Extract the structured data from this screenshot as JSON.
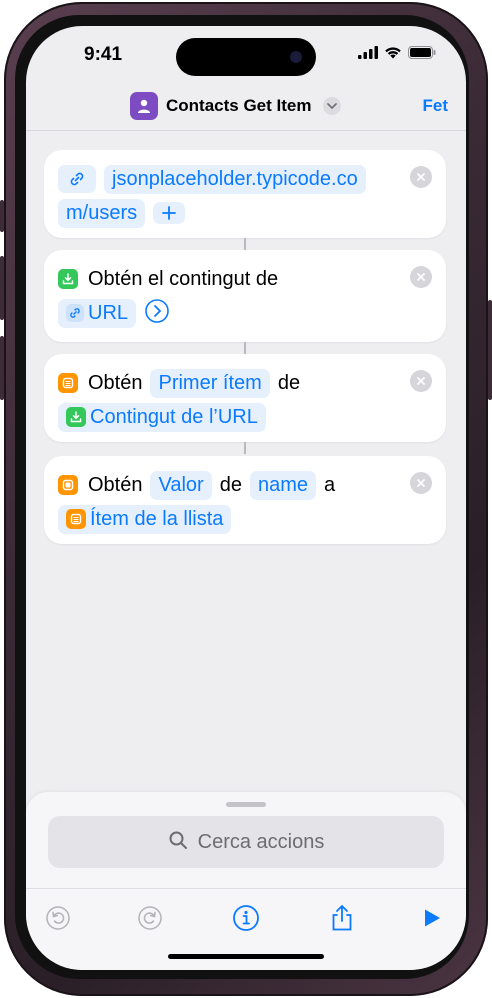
{
  "status": {
    "time": "9:41"
  },
  "nav": {
    "title": "Contacts Get Item",
    "done_label": "Fet"
  },
  "actions": {
    "url": {
      "line1": "jsonplaceholder.typicode.co",
      "line2": "m/users"
    },
    "get_contents": {
      "text": "Obtén el contingut de",
      "token": "URL"
    },
    "get_item": {
      "verb": "Obtén",
      "token_item": "Primer ítem",
      "of": "de",
      "token_source": "Contingut de l’URL"
    },
    "get_value": {
      "verb": "Obtén",
      "token_value": "Valor",
      "of": "de",
      "token_key": "name",
      "in": "a",
      "token_source": "Ítem de la llista"
    }
  },
  "sheet": {
    "search_placeholder": "Cerca accions"
  },
  "colors": {
    "accent": "#0a7aff",
    "app_icon": "#7d4cc2",
    "green": "#34c759",
    "orange": "#ff9500"
  }
}
